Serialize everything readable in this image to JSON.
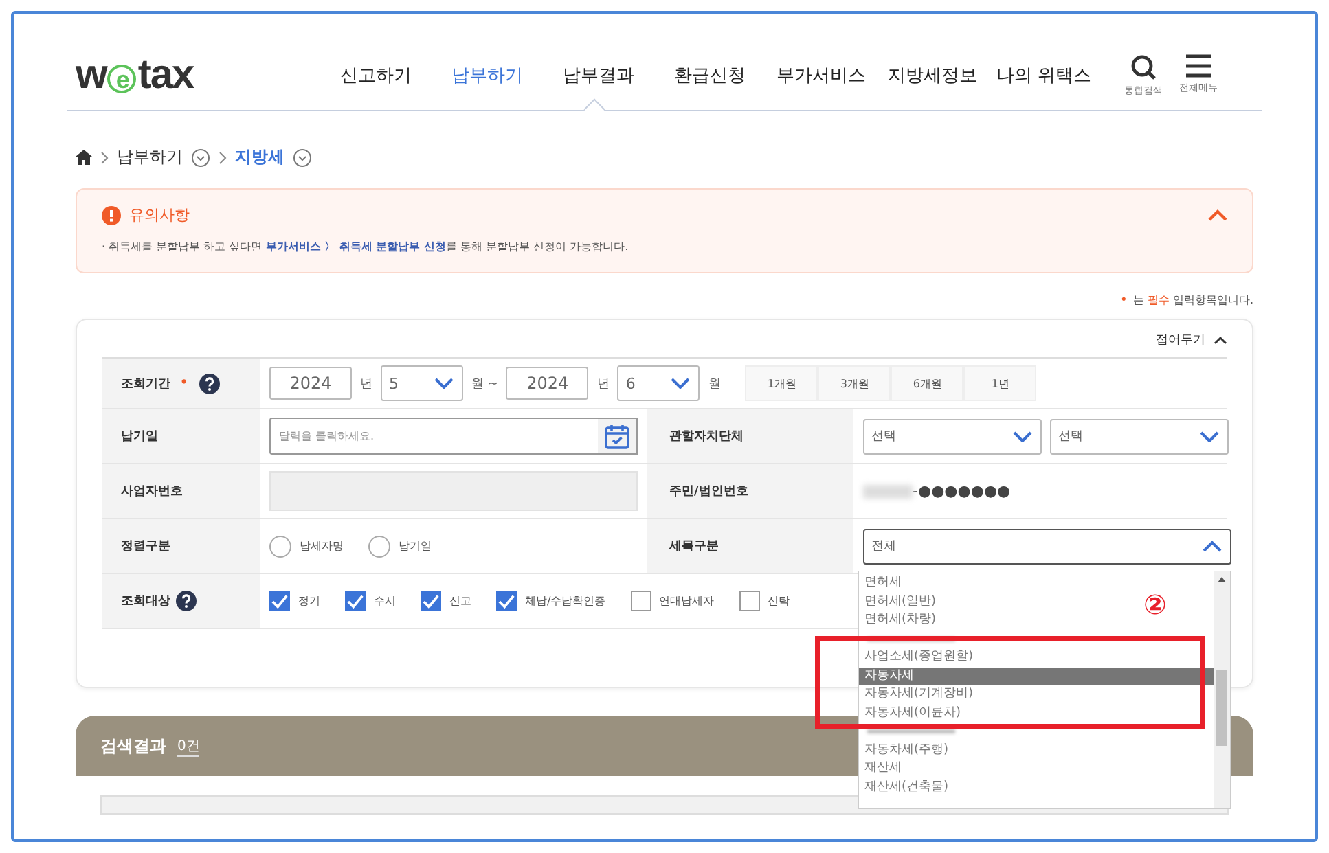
{
  "header": {
    "logo": {
      "before": "w",
      "mark": "e",
      "after": "tax"
    },
    "nav": [
      {
        "label": "신고하기",
        "selected": false
      },
      {
        "label": "납부하기",
        "selected": true
      },
      {
        "label": "납부결과",
        "selected": false
      },
      {
        "label": "환급신청",
        "selected": false
      },
      {
        "label": "부가서비스",
        "selected": false
      },
      {
        "label": "지방세정보",
        "selected": false
      },
      {
        "label": "나의 위택스",
        "selected": false
      }
    ],
    "tools": [
      {
        "kind": "search",
        "label": "통합검색"
      },
      {
        "kind": "menu",
        "label": "전체메뉴"
      }
    ]
  },
  "breadcrumb": [
    "납부하기",
    "지방세"
  ],
  "notice": {
    "title": "유의사항",
    "expanded": true,
    "text": "· 취득세를 분할납부 하고 싶다면 **부가서비스 〉 취득세 분할납부 신청**를 통해 분할납부 신청이 가능합니다."
  },
  "required_note": {
    "mark": "•",
    "text": "는 **필수** 입력항목입니다."
  },
  "form": {
    "collapse_label": "접어두기",
    "expanded": true,
    "period": {
      "label": "조회기간",
      "required_mark": "•",
      "from_year": "2024",
      "from_year_unit": "년",
      "from_month": "5",
      "month_unit": "월 ~",
      "to_year": "2024",
      "to_year_unit": "년",
      "to_month": "6",
      "end_unit": "월",
      "quick": [
        "1개월",
        "3개월",
        "6개월",
        "1년"
      ]
    },
    "due_date": {
      "label": "납기일",
      "placeholder": "달력을 클릭하세요."
    },
    "region": {
      "label": "관할자치단체",
      "selects": [
        "선택",
        "선택"
      ]
    },
    "business_no": {
      "label": "사업자번호"
    },
    "resident_no": {
      "label": "주민/법인번호",
      "value": "-●●●●●●●"
    },
    "sort": {
      "label": "정렬구분",
      "options": [
        {
          "label": "납세자명",
          "selected": false
        },
        {
          "label": "납기일",
          "selected": false
        }
      ]
    },
    "tax_type": {
      "label": "세목구분",
      "value": "전체",
      "expanded": true,
      "options": [
        {
          "label": "면허세",
          "selected": false
        },
        {
          "label": "면허세(일반)",
          "selected": false
        },
        {
          "label": "면허세(차량)",
          "selected": false
        },
        {
          "kind": "hidden"
        },
        {
          "label": "사업소세(종업원할)",
          "selected": false
        },
        {
          "label": "자동차세",
          "selected": true
        },
        {
          "label": "자동차세(기계장비)",
          "selected": false
        },
        {
          "label": "자동차세(이륜차)",
          "selected": false
        },
        {
          "kind": "hidden"
        },
        {
          "label": "자동차세(주행)",
          "selected": false
        },
        {
          "label": "재산세",
          "selected": false
        },
        {
          "label": "재산세(건축물)",
          "selected": false
        }
      ]
    },
    "target": {
      "label": "조회대상",
      "options": [
        {
          "label": "정기",
          "checked": true
        },
        {
          "label": "수시",
          "checked": true
        },
        {
          "label": "신고",
          "checked": true
        },
        {
          "label": "체납/수납확인증",
          "checked": true
        },
        {
          "label": "연대납세자",
          "checked": false
        },
        {
          "label": "신탁",
          "checked": false
        }
      ]
    }
  },
  "results": {
    "title": "검색결과",
    "count": "0건"
  },
  "annotation": {
    "number": "②"
  }
}
